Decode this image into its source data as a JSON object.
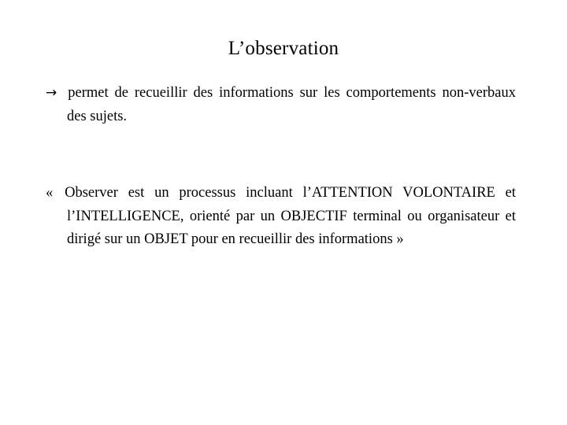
{
  "slide": {
    "title": "L’observation",
    "background_color": "#ffffff",
    "text_color": "#000000",
    "paragraphs": [
      {
        "bullet": "→",
        "text": "permet de recueillir des informations sur les comportements non-verbaux des sujets."
      },
      {
        "bullet": "«",
        "text": "Observer est un processus incluant l’ATTENTION VOLONTAIRE et l’INTELLIGENCE, orienté par un OBJECTIF terminal ou organisateur et dirigé sur un OBJET pour en recueillir des informations »"
      }
    ]
  }
}
